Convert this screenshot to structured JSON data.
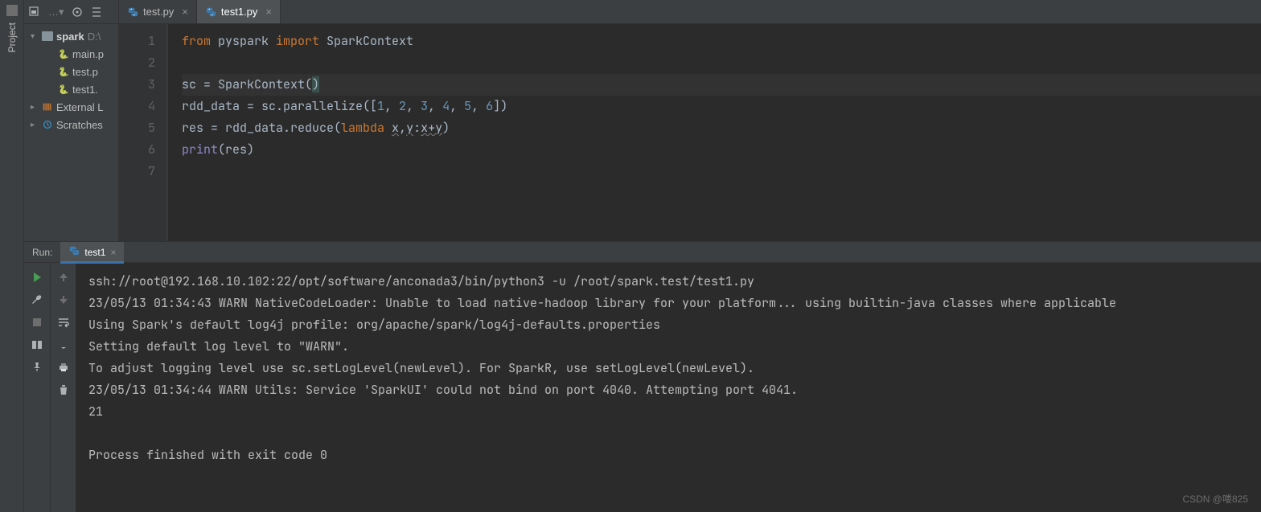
{
  "sidebar_tab": "Project",
  "toolbar": {
    "menu_icon": "project-dropdown",
    "target_icon": "select-opened-file",
    "expand_icon": "expand-all",
    "settings_icon": "collapse-all"
  },
  "tree": {
    "root": {
      "name": "spark",
      "drive": "D:\\"
    },
    "files": [
      "main.p",
      "test.p",
      "test1."
    ],
    "external": "External L",
    "scratches": "Scratches"
  },
  "tabs": [
    {
      "name": "test.py",
      "active": false
    },
    {
      "name": "test1.py",
      "active": true
    }
  ],
  "code": {
    "lines": [
      {
        "n": 1,
        "tokens": [
          [
            "kw",
            "from"
          ],
          [
            "",
            " pyspark "
          ],
          [
            "kw",
            "import"
          ],
          [
            "",
            " SparkContext"
          ]
        ]
      },
      {
        "n": 2,
        "tokens": []
      },
      {
        "n": 3,
        "tokens": [
          [
            "",
            "sc = SparkContext"
          ],
          [
            "paren",
            "("
          ],
          [
            "paren-hl",
            ")"
          ]
        ]
      },
      {
        "n": 4,
        "tokens": [
          [
            "",
            "rdd_data = sc.parallelize(["
          ],
          [
            "num",
            "1"
          ],
          [
            "",
            ", "
          ],
          [
            "num",
            "2"
          ],
          [
            "",
            ", "
          ],
          [
            "num",
            "3"
          ],
          [
            "",
            ", "
          ],
          [
            "num",
            "4"
          ],
          [
            "",
            ", "
          ],
          [
            "num",
            "5"
          ],
          [
            "",
            ", "
          ],
          [
            "num",
            "6"
          ],
          [
            "",
            "])"
          ]
        ]
      },
      {
        "n": 5,
        "tokens": [
          [
            "",
            "res = rdd_data.reduce("
          ],
          [
            "kw",
            "lambda"
          ],
          [
            "",
            " "
          ],
          [
            "warn",
            "x"
          ],
          [
            "",
            ","
          ],
          [
            "warn",
            "y"
          ],
          [
            "",
            ":"
          ],
          [
            "warn",
            "x+y"
          ],
          [
            "",
            ")"
          ]
        ]
      },
      {
        "n": 6,
        "tokens": [
          [
            "builtin",
            "print"
          ],
          [
            "",
            "(res)"
          ]
        ]
      },
      {
        "n": 7,
        "tokens": []
      }
    ]
  },
  "run": {
    "label": "Run:",
    "tab": "test1",
    "output": [
      "ssh://root@192.168.10.102:22/opt/software/anconada3/bin/python3 -u /root/spark.test/test1.py",
      "23/05/13 01:34:43 WARN NativeCodeLoader: Unable to load native-hadoop library for your platform... using builtin-java classes where applicable",
      "Using Spark's default log4j profile: org/apache/spark/log4j-defaults.properties",
      "Setting default log level to \"WARN\".",
      "To adjust logging level use sc.setLogLevel(newLevel). For SparkR, use setLogLevel(newLevel).",
      "23/05/13 01:34:44 WARN Utils: Service 'SparkUI' could not bind on port 4040. Attempting port 4041.",
      "21",
      "",
      "Process finished with exit code 0"
    ]
  },
  "watermark": "CSDN @喽825"
}
